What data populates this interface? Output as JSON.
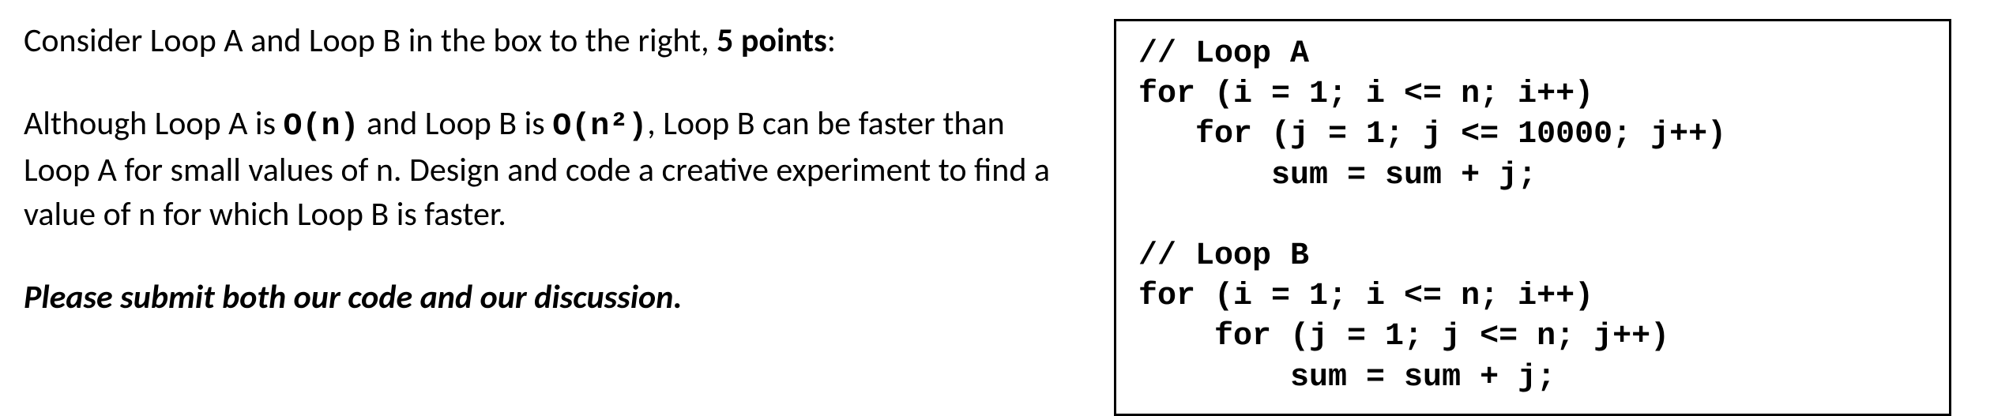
{
  "prose": {
    "p1_prefix": "Consider Loop A and Loop B in the box to the right, ",
    "p1_bold": "5 points",
    "p1_suffix": ":",
    "p2_a": "Although Loop A is ",
    "p2_code1": "O(n)",
    "p2_b": " and Loop B is ",
    "p2_code2": "O(n²)",
    "p2_c": ", Loop B can be faster than Loop A for small values of n. Design and code a creative experiment to find a value of n for which Loop B is faster.",
    "p3": "Please submit both our code and our discussion."
  },
  "code": {
    "l01": "// Loop A",
    "l02": "for (i = 1; i <= n; i++)",
    "l03": "   for (j = 1; j <= 10000; j++)",
    "l04": "       sum = sum + j;",
    "l05": "",
    "l06": "// Loop B",
    "l07": "for (i = 1; i <= n; i++)",
    "l08": "    for (j = 1; j <= n; j++)",
    "l09": "        sum = sum + j;"
  }
}
